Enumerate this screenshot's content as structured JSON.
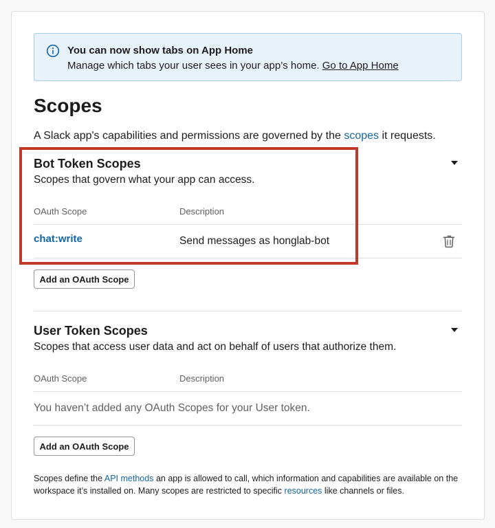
{
  "banner": {
    "icon": "info-icon",
    "title": "You can now show tabs on App Home",
    "body": "Manage which tabs your user sees in your app’s home.",
    "link": "Go to App Home"
  },
  "heading": "Scopes",
  "intro": {
    "before": "A Slack app's capabilities and permissions are governed by the",
    "link": "scopes",
    "after": "it requests."
  },
  "bot": {
    "title": "Bot Token Scopes",
    "subtitle": "Scopes that govern what your app can access.",
    "col_scope": "OAuth Scope",
    "col_desc": "Description",
    "scopes": [
      {
        "name": "chat:write",
        "description": "Send messages as honglab-bot"
      }
    ],
    "add_button": "Add an OAuth Scope"
  },
  "user": {
    "title": "User Token Scopes",
    "subtitle": "Scopes that access user data and act on behalf of users that authorize them.",
    "col_scope": "OAuth Scope",
    "col_desc": "Description",
    "empty": "You haven’t added any OAuth Scopes for your User token.",
    "add_button": "Add an OAuth Scope"
  },
  "footer": {
    "p1": "Scopes define the",
    "link1": "API methods",
    "p2": "an app is allowed to call, which information and capabilities are available on the workspace it’s installed on. Many scopes are restricted to specific",
    "link2": "resources",
    "p3": "like channels or files."
  },
  "colors": {
    "link": "#1264a3",
    "banner_bg": "#e8f2fa",
    "highlight": "#c0392b"
  }
}
